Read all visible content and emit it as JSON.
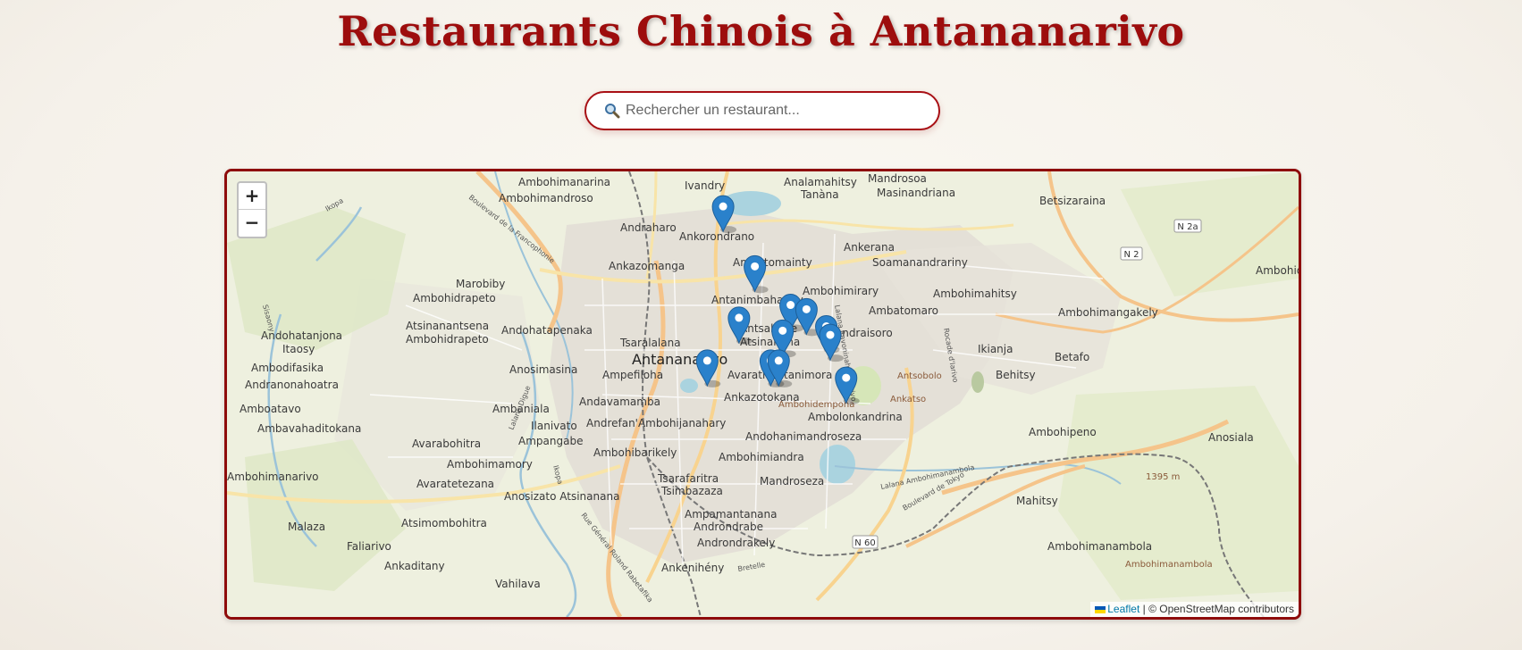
{
  "page": {
    "title": "Restaurants Chinois à Antananarivo"
  },
  "search": {
    "icon": "magnifier-emoji",
    "placeholder": "Rechercher un restaurant..."
  },
  "map": {
    "zoom_in_label": "+",
    "zoom_out_label": "−",
    "attribution_link": "Leaflet",
    "attribution_text": "| © OpenStreetMap contributors",
    "city_label": "Antananarivo",
    "place_labels": [
      "Ambohimanarina",
      "Ambohimandroso",
      "Ivandry",
      "Analamahitsy",
      "Tanàna",
      "Mandrosoa",
      "Masinandriana",
      "Betsizaraina",
      "Andraharo",
      "Ankorondrano",
      "Ankerana",
      "Soamanandrariny",
      "Ambatomainty",
      "Ankazomanga",
      "Marobiby",
      "Ambohidrapeto",
      "Ambohimirary",
      "Ambohimahitsy",
      "Ambohidahy",
      "Antanimbahangy",
      "Ambatomaro",
      "Ambohimangakely",
      "Andohatanjona",
      "Itaosy",
      "Atsinanantsena",
      "Ambohidrapeto",
      "Andohatapenaka",
      "Antsahabe",
      "Atsinanana",
      "Andraisoro",
      "Ikianja",
      "Betafo",
      "Ambodifasika",
      "Anosimasina",
      "Ampefiloha",
      "Tsaralalana",
      "Avaratr'Antanimora",
      "Behitsy",
      "Andranonahoatra",
      "Andavamamba",
      "Ankazotokana",
      "Antsobolo",
      "Ankatso",
      "Amboatavo",
      "Ambaniala",
      "Ambohidempona",
      "Ambolonkandrina",
      "Ambavahaditokana",
      "Ilanivato",
      "Andrefan'Ambohijanahary",
      "Ambohipeno",
      "Anosiala",
      "Ampangabe",
      "Andohanimandroseza",
      "Avarabohitra",
      "Ambohibarikely",
      "Ambohimiandra",
      "Ambohimamory",
      "Avaratetezana",
      "Tsarafaritra",
      "Mandroseza",
      "Tsimbazaza",
      "Anosizato Atsinanana",
      "Mahitsy",
      "Ampamantanana",
      "Androndrabe",
      "Malaza",
      "Atsimombohitra",
      "Faliarivo",
      "Androndrakely",
      "Ambohimanambola",
      "Ankaditany",
      "Vahilava",
      "Ankenihény",
      "Ambohimanambola",
      "Ambohimalaza",
      "Ambohimanarivo"
    ],
    "road_labels": [
      "Boulevard de la Francophonie",
      "Ikopa",
      "Sisaony",
      "Lalana Digue",
      "Ikopa",
      "Lalana Ambohimanambola",
      "Boulevard de Tokyo",
      "Rue Général Roland Rabetafika",
      "Bretelle",
      "Rocade d'Iarivo",
      "Lalana Ravoninahitriniarivo"
    ],
    "route_shields": [
      "N 2a",
      "N 2",
      "N 60"
    ],
    "elevation_label": "1395 m",
    "markers": [
      {
        "name": "restaurant-1",
        "lat": -18.87,
        "lng": 47.52
      },
      {
        "name": "restaurant-2",
        "lat": -18.884,
        "lng": 47.528
      },
      {
        "name": "restaurant-3",
        "lat": -18.896,
        "lng": 47.524
      },
      {
        "name": "restaurant-4",
        "lat": -18.893,
        "lng": 47.537
      },
      {
        "name": "restaurant-5",
        "lat": -18.894,
        "lng": 47.541
      },
      {
        "name": "restaurant-6",
        "lat": -18.899,
        "lng": 47.535
      },
      {
        "name": "restaurant-7",
        "lat": -18.898,
        "lng": 47.546
      },
      {
        "name": "restaurant-8",
        "lat": -18.9,
        "lng": 47.547
      },
      {
        "name": "restaurant-9",
        "lat": -18.906,
        "lng": 47.532
      },
      {
        "name": "restaurant-10",
        "lat": -18.906,
        "lng": 47.534
      },
      {
        "name": "restaurant-11",
        "lat": -18.906,
        "lng": 47.516
      },
      {
        "name": "restaurant-12",
        "lat": -18.91,
        "lng": 47.551
      }
    ]
  },
  "colors": {
    "title": "#9d0d0d",
    "border": "#a80f14",
    "marker": "#2a81cb",
    "leaflet_link": "#0078a8"
  }
}
